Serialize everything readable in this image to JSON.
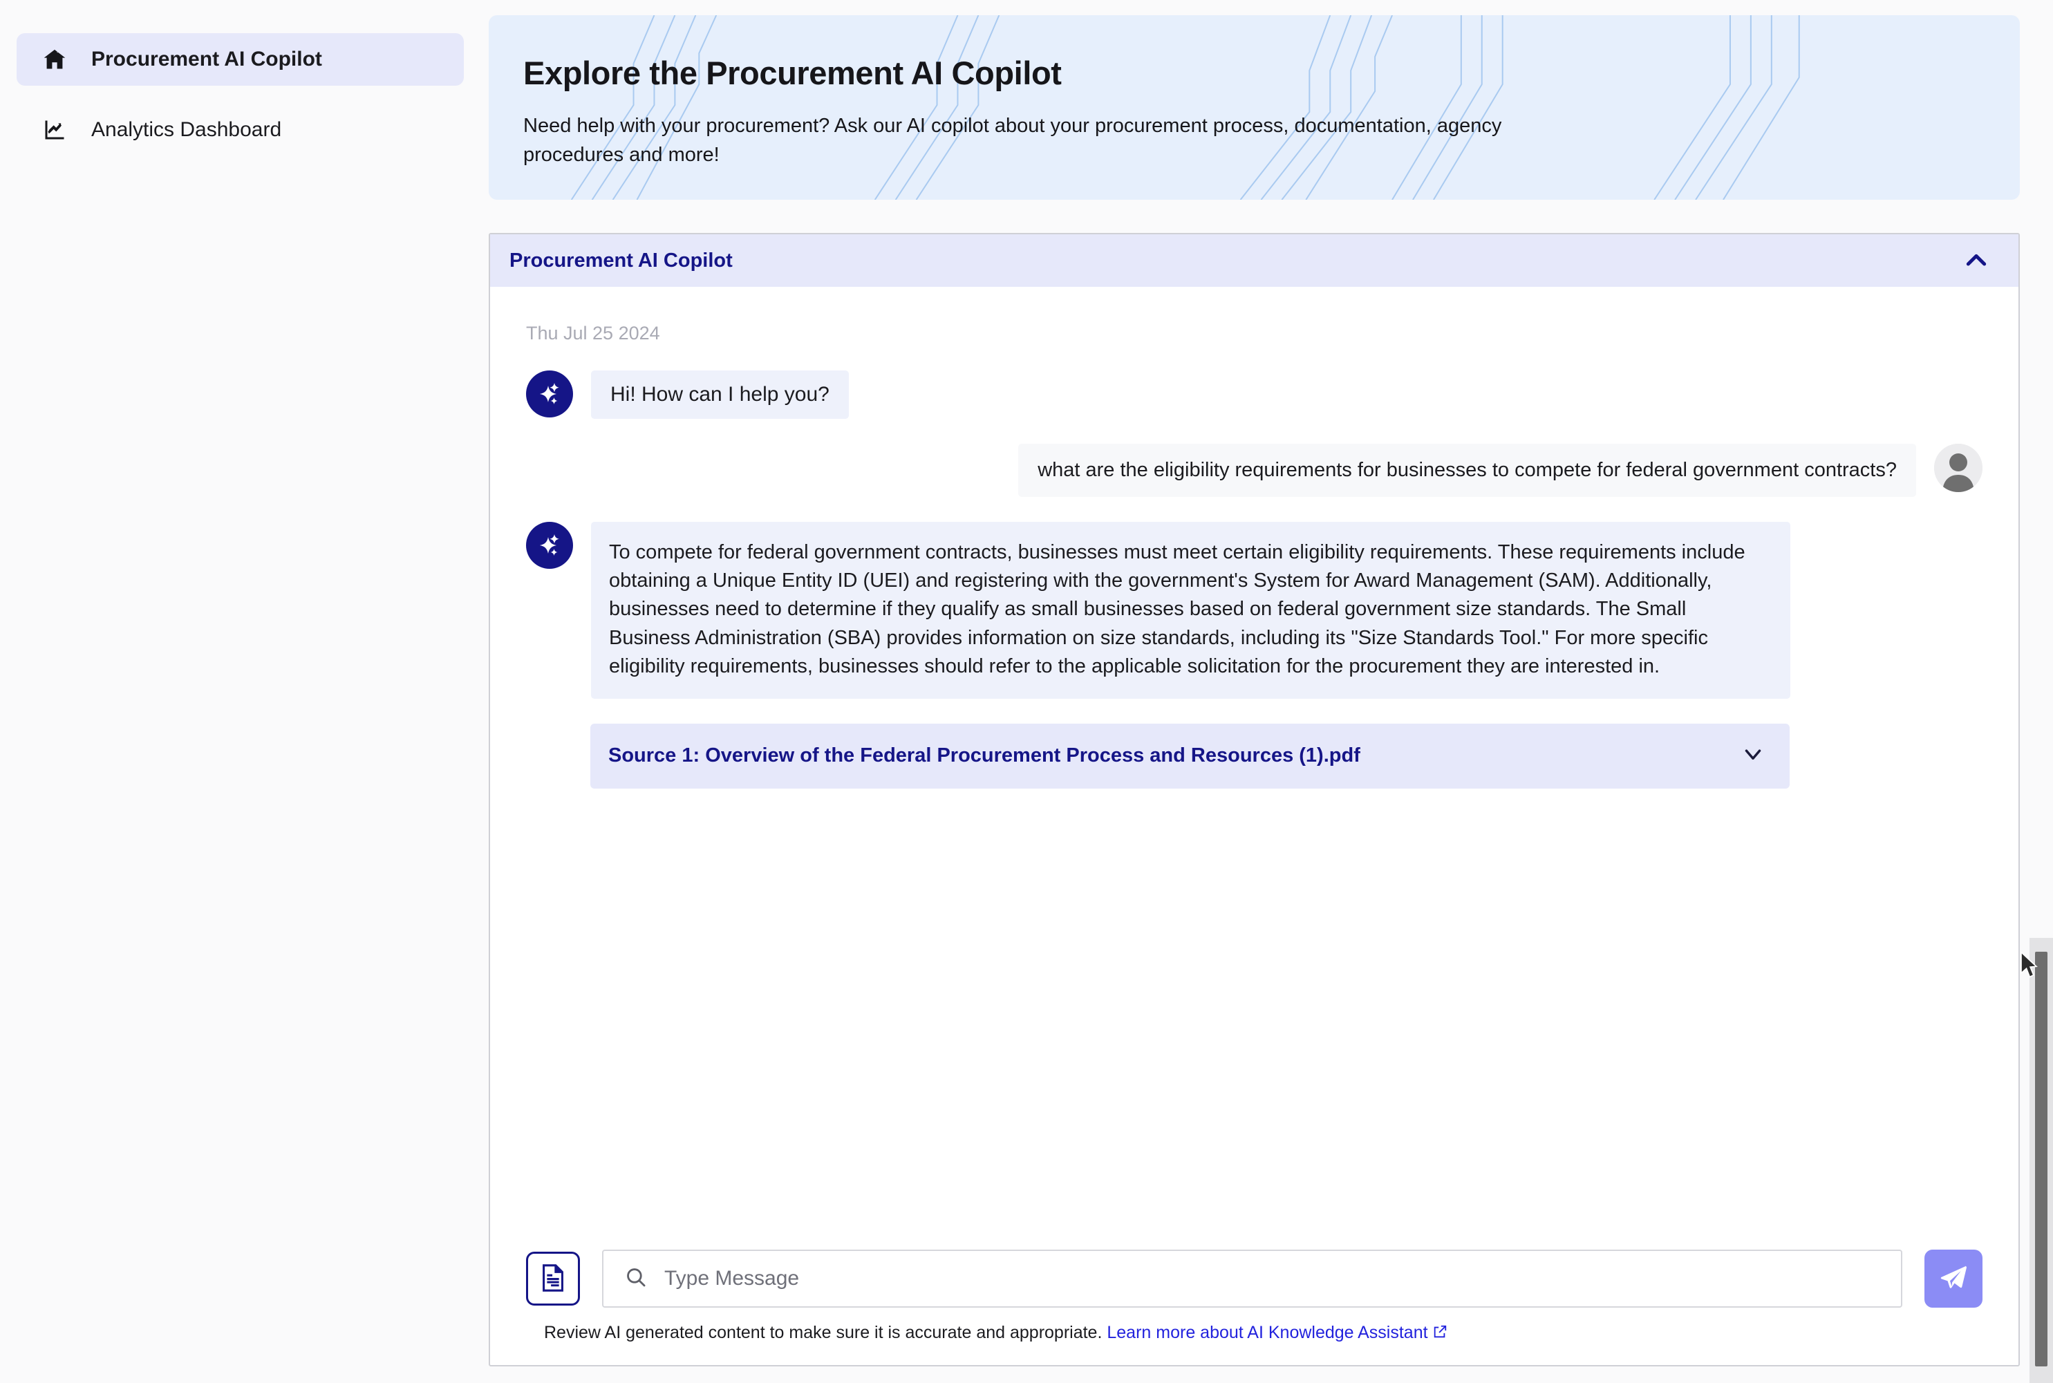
{
  "sidebar": {
    "items": [
      {
        "label": "Procurement AI Copilot",
        "icon": "home-icon",
        "active": true
      },
      {
        "label": "Analytics Dashboard",
        "icon": "line-chart-icon",
        "active": false
      }
    ]
  },
  "hero": {
    "title": "Explore the Procurement AI Copilot",
    "subtitle": "Need help with your procurement? Ask our AI copilot about your procurement process, documentation, agency procedures and more!",
    "background_color": "#e6effc"
  },
  "panel": {
    "title": "Procurement AI Copilot",
    "collapse_icon": "chevron-up-icon",
    "header_color": "#e6e8fa",
    "title_color": "#151587"
  },
  "chat": {
    "date": "Thu Jul 25 2024",
    "messages": [
      {
        "sender": "ai",
        "avatar": "sparkle-avatar-icon",
        "text": "Hi! How can I help you?"
      },
      {
        "sender": "user",
        "avatar": "user-avatar-icon",
        "text": "what are the eligibility requirements for businesses to compete for federal government contracts?"
      },
      {
        "sender": "ai",
        "avatar": "sparkle-avatar-icon",
        "text": "To compete for federal government contracts, businesses must meet certain eligibility requirements. These requirements include obtaining a Unique Entity ID (UEI) and registering with the government's System for Award Management (SAM). Additionally, businesses need to determine if they qualify as small businesses based on federal government size standards. The Small Business Administration (SBA) provides information on size standards, including its \"Size Standards Tool.\" For more specific eligibility requirements, businesses should refer to the applicable solicitation for the procurement they are interested in."
      }
    ],
    "sources": [
      {
        "label": "Source 1: Overview of the Federal Procurement Process and Resources (1).pdf",
        "expand_icon": "chevron-down-icon"
      }
    ]
  },
  "composer": {
    "attach_icon": "document-icon",
    "search_icon": "search-icon",
    "placeholder": "Type Message",
    "value": "",
    "send_icon": "send-paper-plane-icon",
    "send_color": "#8b8cf5"
  },
  "footer": {
    "disclaimer": "Review AI generated content to make sure it is accurate and appropriate.",
    "link_text": "Learn more about AI Knowledge Assistant",
    "link_icon": "external-link-icon",
    "link_color": "#2222dd"
  }
}
